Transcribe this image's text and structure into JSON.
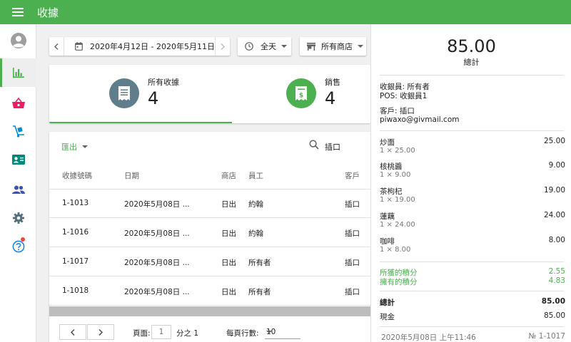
{
  "app": {
    "title": "收據"
  },
  "filters": {
    "date_range": "2020年4月12日 - 2020年5月11日",
    "time": "全天",
    "store": "所有商店"
  },
  "stats": [
    {
      "label": "所有收據",
      "value": "4",
      "icon": "receipt-icon",
      "color": "#607d8b"
    },
    {
      "label": "銷售",
      "value": "4",
      "icon": "sale-receipt-icon",
      "color": "#4caf50"
    }
  ],
  "table": {
    "export_label": "匯出",
    "search_value": "插口",
    "columns": [
      "收據號碼",
      "日期",
      "商店",
      "員工",
      "客戶"
    ],
    "rows": [
      [
        "1-1013",
        "2020年5月08日 ...",
        "日出",
        "約翰",
        "插口"
      ],
      [
        "1-1016",
        "2020年5月08日 ...",
        "日出",
        "約翰",
        "插口"
      ],
      [
        "1-1017",
        "2020年5月08日 ...",
        "日出",
        "所有者",
        "插口"
      ],
      [
        "1-1018",
        "2020年5月08日 ...",
        "日出",
        "所有者",
        "插口"
      ]
    ],
    "pager": {
      "page_label": "頁面:",
      "page_value": "1",
      "of_label": "分之 1",
      "rows_label": "每頁行數:",
      "rows_value": "10"
    }
  },
  "receipt": {
    "total": "85.00",
    "total_label": "總計",
    "cashier": "收銀員: 所有者",
    "pos": "POS: 收銀員1",
    "customer": "客戶: 插口",
    "email": "piwaxo@givmail.com",
    "items": [
      {
        "name": "炒面",
        "qty": "1 × 25.00",
        "price": "25.00"
      },
      {
        "name": "核桃醬",
        "qty": "1 × 9.00",
        "price": "9.00"
      },
      {
        "name": "茶枸杞",
        "qty": "1 × 19.00",
        "price": "19.00"
      },
      {
        "name": "蓮藕",
        "qty": "1 × 24.00",
        "price": "24.00"
      },
      {
        "name": "咖啡",
        "qty": "1 × 8.00",
        "price": "8.00"
      }
    ],
    "points_earned_label": "所獲的積分",
    "points_earned": "2.55",
    "points_balance_label": "擁有的積分",
    "points_balance": "4.83",
    "summary_total_label": "總計",
    "summary_total": "85.00",
    "cash_label": "現金",
    "cash": "85.00",
    "datetime": "2020年5月08日 上午11:46",
    "number": "№ 1-1017"
  },
  "colors": {
    "accent": "#4caf50"
  }
}
